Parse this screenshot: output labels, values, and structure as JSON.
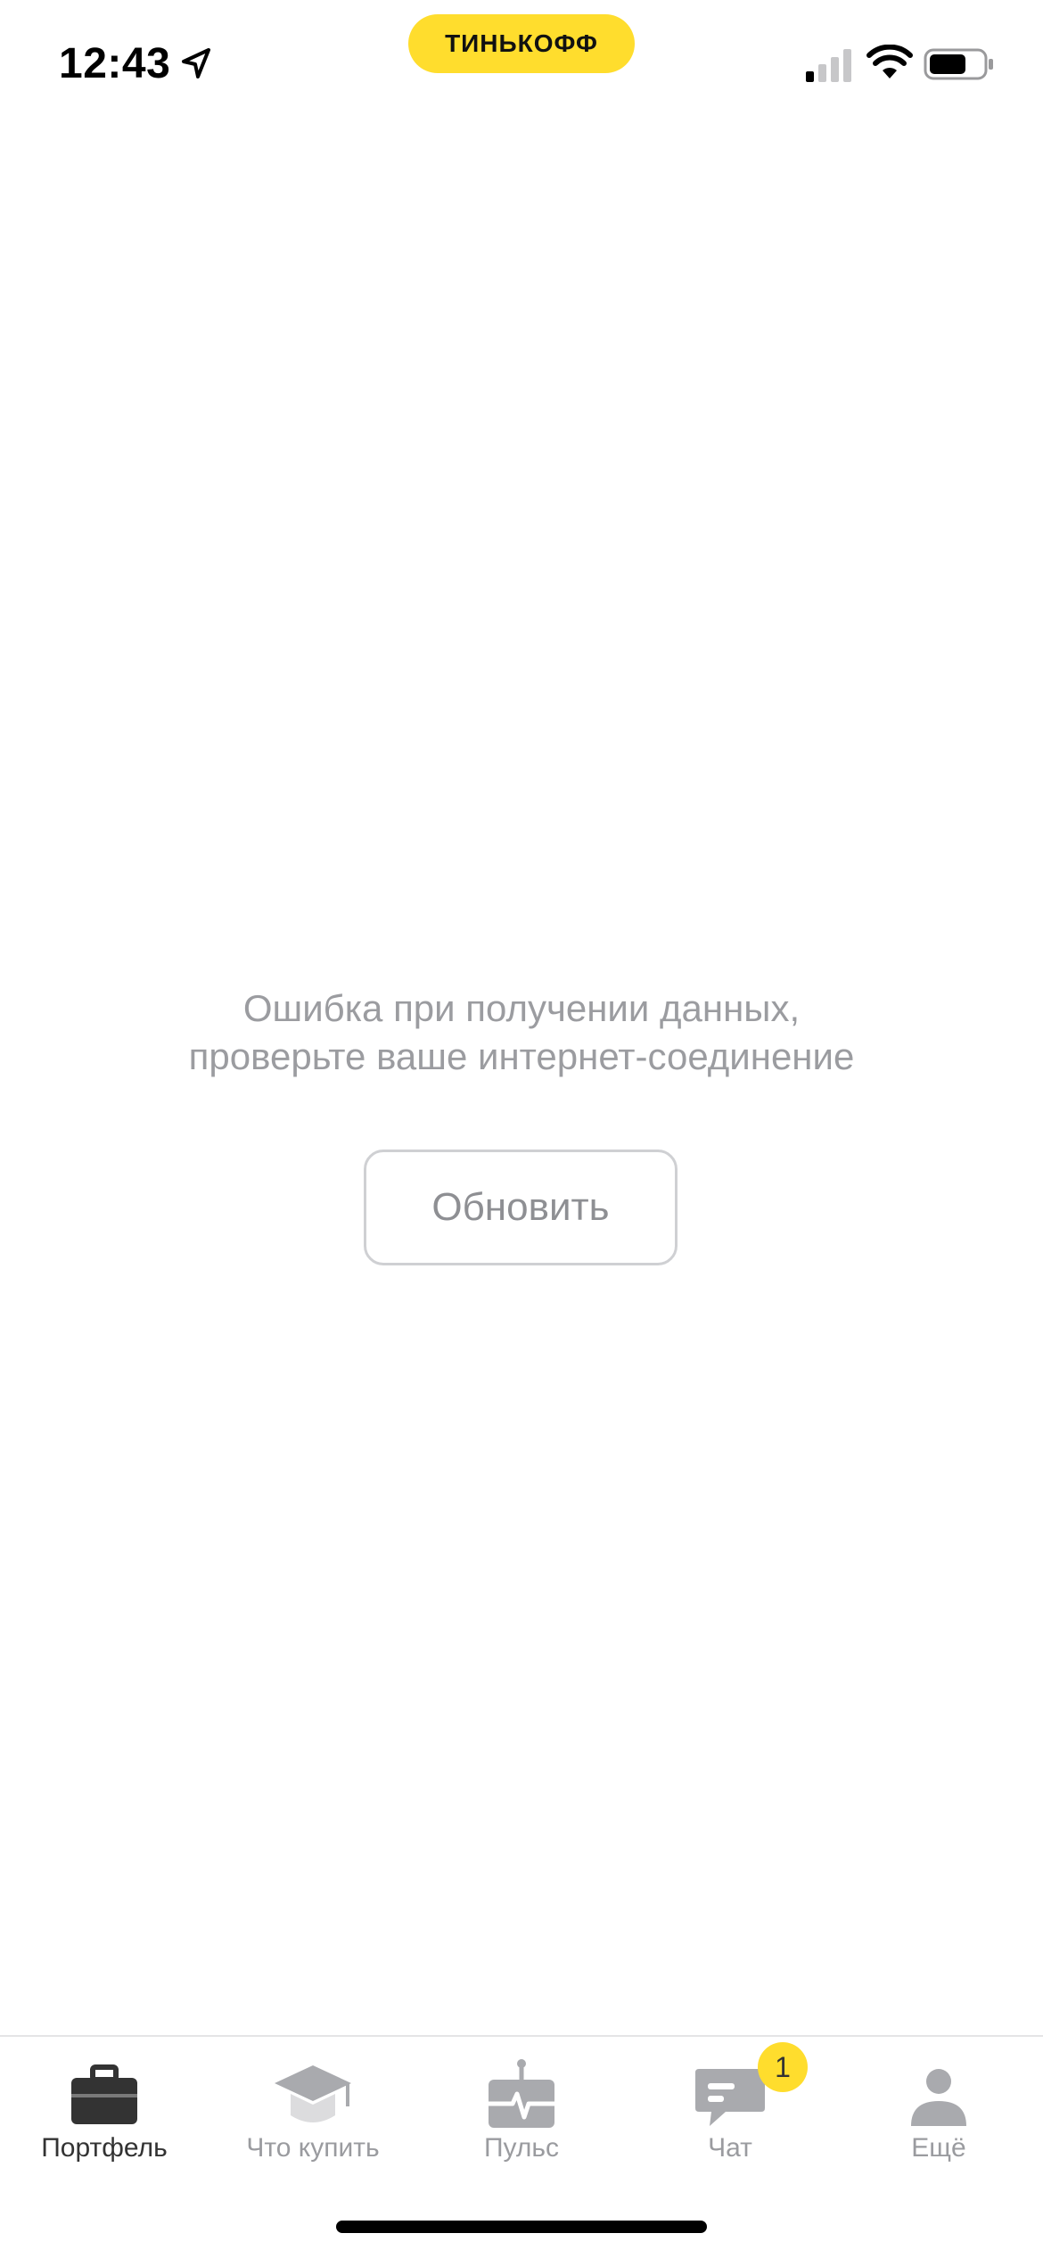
{
  "status_bar": {
    "time": "12:43",
    "brand": "ТИНЬКОФФ"
  },
  "error": {
    "line1": "Ошибка при получении данных,",
    "line2": "проверьте ваше интернет-соединение"
  },
  "refresh_button": {
    "label": "Обновить"
  },
  "tabs": [
    {
      "label": "Портфель",
      "icon": "briefcase-icon",
      "active": true
    },
    {
      "label": "Что купить",
      "icon": "graduation-cap-icon",
      "active": false
    },
    {
      "label": "Пульс",
      "icon": "pulse-icon",
      "active": false
    },
    {
      "label": "Чат",
      "icon": "chat-icon",
      "active": false
    },
    {
      "label": "Ещё",
      "icon": "profile-icon",
      "active": false
    }
  ],
  "chat_badge": "1",
  "colors": {
    "accent": "#FFDD2D",
    "inactive": "#9A9B9F",
    "active": "#333333"
  }
}
